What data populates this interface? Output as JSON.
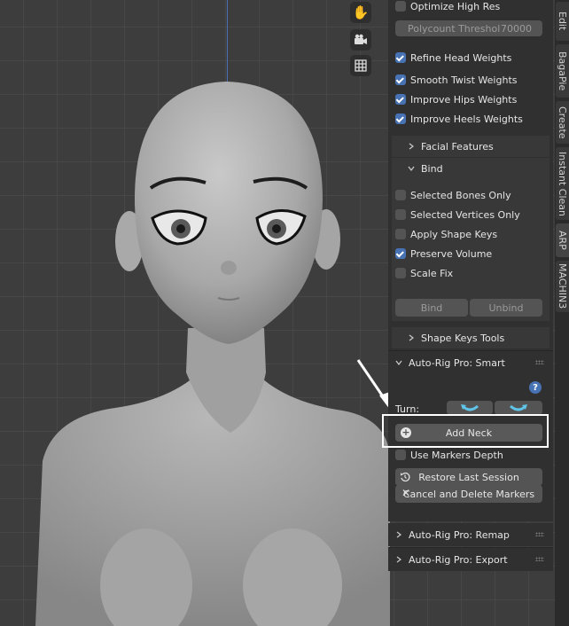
{
  "sidebar": {
    "optimize_high_res": {
      "label": "Optimize High Res",
      "checked": false
    },
    "polycount": {
      "label": "Polycount Threshol",
      "value": "70000"
    },
    "checks": [
      {
        "label": "Refine Head Weights",
        "checked": true
      },
      {
        "label": "Smooth Twist Weights",
        "checked": true
      },
      {
        "label": "Improve Hips Weights",
        "checked": true
      },
      {
        "label": "Improve Heels Weights",
        "checked": true
      }
    ],
    "facial_features": "Facial Features",
    "bind_section": "Bind",
    "bind_checks": [
      {
        "label": "Selected Bones Only",
        "checked": false
      },
      {
        "label": "Selected Vertices Only",
        "checked": false
      },
      {
        "label": "Apply Shape Keys",
        "checked": false
      },
      {
        "label": "Preserve Volume",
        "checked": true
      },
      {
        "label": "Scale Fix",
        "checked": false
      }
    ],
    "bind_button": "Bind",
    "unbind_button": "Unbind",
    "shape_keys_tools": "Shape Keys Tools",
    "smart_panel": "Auto-Rig Pro: Smart",
    "turn_label": "Turn:",
    "add_neck_button": "Add Neck",
    "use_markers_depth": {
      "label": "Use Markers Depth",
      "checked": false
    },
    "restore_session_button": "Restore Last Session",
    "cancel_markers_button": "Cancel and Delete Markers",
    "remap_panel": "Auto-Rig Pro: Remap",
    "export_panel": "Auto-Rig Pro: Export"
  },
  "tabs": [
    "Edit",
    "BagaPie",
    "Create",
    "Instant Clean",
    "ARP",
    "MACHIN3"
  ],
  "active_tab": "ARP",
  "colors": {
    "accent": "#4772b3",
    "highlight_box": "#ffffff",
    "panel_bg": "#303030"
  },
  "icons": [
    "hand-icon",
    "camera-icon",
    "grid-icon",
    "help-icon",
    "add-icon",
    "restore-icon",
    "close-icon"
  ]
}
